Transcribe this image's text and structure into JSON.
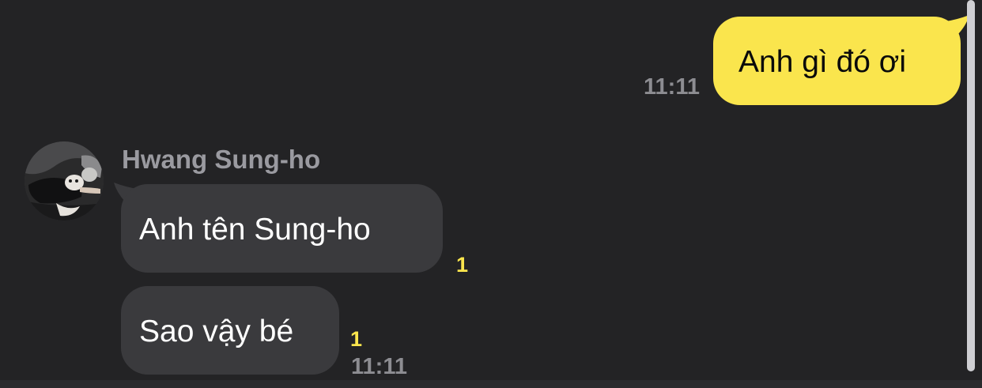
{
  "colors": {
    "background": "#232325",
    "outgoing_bubble": "#fae54d",
    "incoming_bubble": "#3a3a3d",
    "unread_count": "#fae54d",
    "timestamp": "#8d8d92"
  },
  "outgoing": {
    "text": "Anh gì đó ơi",
    "time": "11:11"
  },
  "incoming": {
    "sender_name": "Hwang Sung-ho",
    "avatar_icon": "profile-photo-icon",
    "messages": [
      {
        "text": "Anh tên Sung-ho",
        "unread": "1"
      },
      {
        "text": "Sao vậy bé",
        "unread": "1",
        "time": "11:11"
      }
    ]
  }
}
